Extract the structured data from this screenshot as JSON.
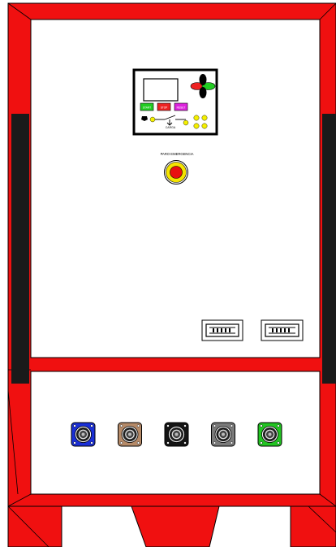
{
  "colors": {
    "cabinet_red": "#f01010",
    "panel_white": "#ffffff",
    "outline": "#000000",
    "side_vent": "#1a1a1a",
    "button_green": "#22cc22",
    "button_red": "#ee2222",
    "button_magenta": "#dd22dd",
    "indicator_yellow": "#f5f000",
    "emergency_red": "#e81010",
    "emergency_ring": "#f5e400"
  },
  "controller": {
    "start_label": "START",
    "stop_label": "STOP",
    "reset_label": "RESET",
    "load_label": "CARGA"
  },
  "emergency": {
    "label": "PARO EMERGENCIA"
  },
  "sockets": [
    {
      "name": "blue-socket",
      "color": "#1a2fd6"
    },
    {
      "name": "brown-socket",
      "color": "#b58a68"
    },
    {
      "name": "black-socket",
      "color": "#141414"
    },
    {
      "name": "gray-socket",
      "color": "#7a7a7a"
    },
    {
      "name": "green-socket",
      "color": "#22c422"
    }
  ]
}
